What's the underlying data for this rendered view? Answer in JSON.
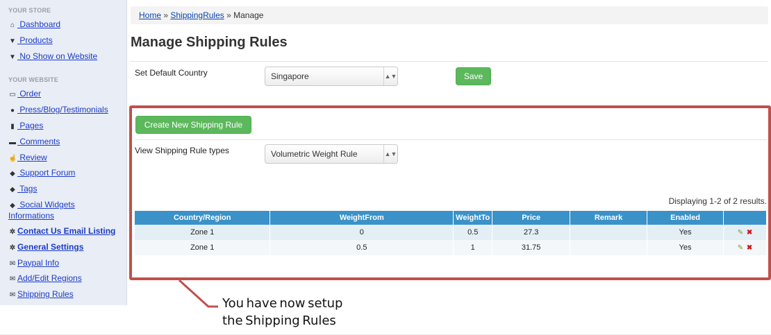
{
  "sidebar": {
    "store_heading": "YOUR STORE",
    "store_items": [
      {
        "label": " Dashboard",
        "icon": "home-icon"
      },
      {
        "label": " Products",
        "icon": "cart-icon"
      },
      {
        "label": " No Show on Website",
        "icon": "cart-icon"
      }
    ],
    "website_heading": "YOUR WEBSITE",
    "website_items": [
      {
        "label": " Order",
        "icon": "monitor-icon"
      },
      {
        "label": " Press/Blog/Testimonials",
        "icon": "user-icon"
      },
      {
        "label": " Pages",
        "icon": "file-icon"
      },
      {
        "label": " Comments",
        "icon": "comment-icon"
      },
      {
        "label": " Review",
        "icon": "thumbs-up-icon"
      },
      {
        "label": " Support Forum",
        "icon": "tag-icon"
      },
      {
        "label": " Tags",
        "icon": "tags-icon"
      },
      {
        "label": " Social Widgets Informations",
        "icon": "tags-icon"
      },
      {
        "label": "Contact Us Email Listing",
        "icon": "gear-icon"
      },
      {
        "label": "General Settings",
        "icon": "gear-icon"
      },
      {
        "label": "Paypal Info",
        "icon": "envelope-icon"
      },
      {
        "label": "Add/Edit Regions",
        "icon": "envelope-icon"
      },
      {
        "label": "Shipping Rules",
        "icon": "envelope-icon"
      }
    ]
  },
  "breadcrumb": {
    "home": "Home",
    "sep1": " » ",
    "shipping": "ShippingRules",
    "sep2": " » ",
    "current": "Manage"
  },
  "page_title": "Manage Shipping Rules",
  "default_country": {
    "label": "Set Default Country",
    "value": "Singapore",
    "save": "Save"
  },
  "create_button": "Create New Shipping Rule",
  "view_types": {
    "label": "View Shipping Rule types",
    "value": "Volumetric Weight Rule"
  },
  "summary": "Displaying 1-2 of 2 results.",
  "table": {
    "headers": [
      "Country/Region",
      "WeightFrom",
      "WeightTo",
      "Price",
      "Remark",
      "Enabled",
      ""
    ],
    "rows": [
      [
        "Zone 1",
        "0",
        "0.5",
        "27.3",
        "",
        "Yes"
      ],
      [
        "Zone 1",
        "0.5",
        "1",
        "31.75",
        "",
        "Yes"
      ]
    ]
  },
  "callout": {
    "line1": "You have now setup ",
    "line2": "the Shipping Rules "
  },
  "colors": {
    "accent_green": "#5cb85c",
    "table_header": "#3a92c9",
    "highlight_red": "#c0504d"
  }
}
